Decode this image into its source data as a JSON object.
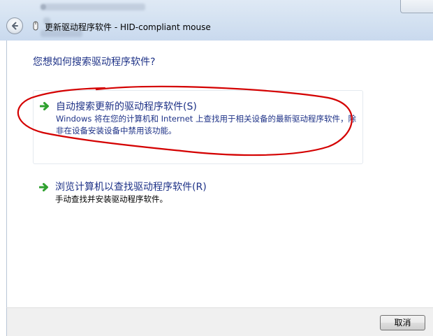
{
  "window": {
    "title": "更新驱动程序软件 - HID-compliant mouse"
  },
  "main": {
    "heading": "您想如何搜索驱动程序软件?",
    "options": [
      {
        "icon": "green-arrow-icon",
        "title": "自动搜索更新的驱动程序软件(S)",
        "description": "Windows 将在您的计算机和 Internet 上查找用于相关设备的最新驱动程序软件，除非在设备安装设备中禁用该功能。"
      },
      {
        "icon": "green-arrow-icon",
        "title": "浏览计算机以查找驱动程序软件(R)",
        "description": "手动查找并安装驱动程序软件。"
      }
    ]
  },
  "footer": {
    "cancel_label": "取消"
  },
  "colors": {
    "link_blue": "#1e3287",
    "arrow_green": "#2fa12f",
    "annotation_red": "#d40000"
  }
}
